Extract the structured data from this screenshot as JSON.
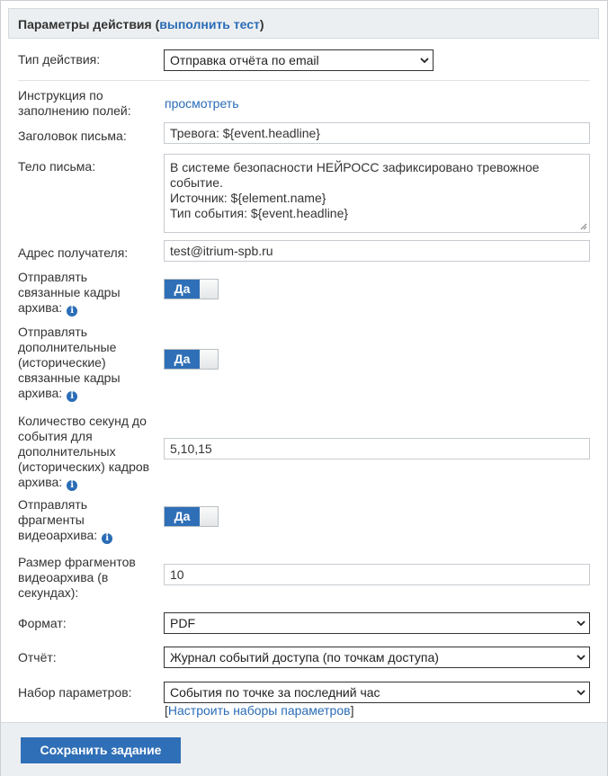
{
  "header": {
    "title": "Параметры действия",
    "run_test_link": "выполнить тест"
  },
  "fields": {
    "action_type": {
      "label": "Тип действия:",
      "value": "Отправка отчёта по email"
    },
    "instruction": {
      "label": "Инструкция по заполнению полей:",
      "link": "просмотреть"
    },
    "subject": {
      "label": "Заголовок письма:",
      "value": "Тревога: ${event.headline}"
    },
    "body": {
      "label": "Тело письма:",
      "lines": [
        "В системе безопасности НЕЙРОСС зафиксировано тревожное",
        "событие.",
        "Источник: ${element.name}",
        "Тип события: ${event.headline}"
      ]
    },
    "recipient": {
      "label": "Адрес получателя:",
      "value": "test@itrium-spb.ru"
    },
    "send_frames": {
      "label": "Отправлять связанные кадры архива:",
      "value": "Да"
    },
    "send_extra_frames": {
      "label": "Отправлять дополнительные (исторические) связанные кадры архива:",
      "value": "Да"
    },
    "seconds_before": {
      "label": "Количество секунд до события для дополнительных (исторических) кадров архива:",
      "value": "5,10,15"
    },
    "send_fragments": {
      "label": "Отправлять фрагменты видеоархива:",
      "value": "Да"
    },
    "fragment_size": {
      "label": "Размер фрагментов видеоархива (в секундах):",
      "value": "10"
    },
    "format": {
      "label": "Формат:",
      "value": "PDF"
    },
    "report": {
      "label": "Отчёт:",
      "value": "Журнал событий доступа (по точкам доступа)"
    },
    "param_set": {
      "label": "Набор параметров:",
      "value": "События по точке за последний час",
      "configure_link": "Настроить наборы параметров"
    }
  },
  "footer": {
    "save_label": "Сохранить задание"
  },
  "icons": {
    "info": "info-icon",
    "dropdown": "chevron-down-icon",
    "resize": "resize-grip-icon"
  },
  "colors": {
    "accent": "#2f6fb7",
    "link": "#2a6cb6",
    "header_bg": "#eceff1"
  }
}
